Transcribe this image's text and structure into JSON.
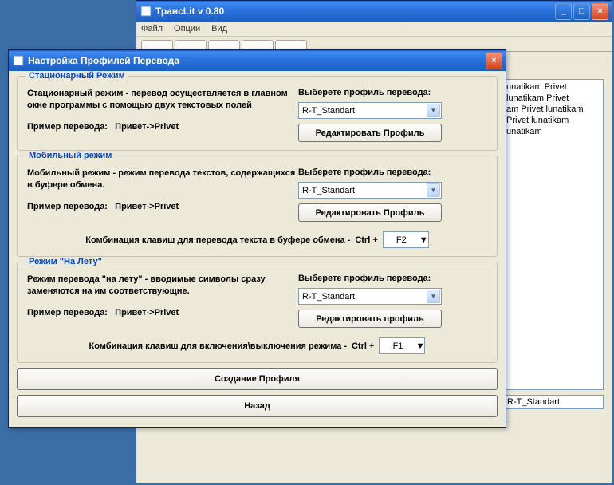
{
  "main_window": {
    "title": "ТрансLit v 0.80",
    "menu": {
      "file": "Файл",
      "options": "Опции",
      "view": "Вид"
    },
    "text_content": "unatikam Privet lunatikam Privet\nam Privet lunatikam Privet lunatikam\nunatikam",
    "status": "R-T_Standart"
  },
  "dialog": {
    "title": "Настройка Профилей Перевода",
    "group_stationary": {
      "title": "Стационарный Режим",
      "desc": "Стационарный режим - перевод осуществляется в главном окне программы с помощью двух текстовых полей",
      "example_label": "Пример перевода:",
      "example_value": "Привет->Privet",
      "select_label": "Выберете профиль перевода:",
      "select_value": "R-T_Standart",
      "edit_button": "Редактировать Профиль"
    },
    "group_mobile": {
      "title": "Мобильный режим",
      "desc": "Мобильный режим - режим перевода текстов, содержащихся в буфере обмена.",
      "example_label": "Пример перевода:",
      "example_value": "Привет->Privet",
      "select_label": "Выберете профиль перевода:",
      "select_value": "R-T_Standart",
      "edit_button": "Редактировать Профиль",
      "hotkey_label": "Комбинация клавиш для перевода текста в буфере обмена -",
      "hotkey_prefix": "Ctrl +",
      "hotkey_value": "F2"
    },
    "group_onfly": {
      "title": "Режим \"На Лету\"",
      "desc": "Режим перевода \"на лету\" - вводимые символы сразу заменяются на им соответствующие.",
      "example_label": "Пример перевода:",
      "example_value": "Привет->Privet",
      "select_label": "Выберете профиль перевода:",
      "select_value": "R-T_Standart",
      "edit_button": "Редактировать профиль",
      "hotkey_label": "Комбинация клавиш для включения\\выключения режима -",
      "hotkey_prefix": "Ctrl +",
      "hotkey_value": "F1"
    },
    "create_button": "Создание Профиля",
    "back_button": "Назад"
  }
}
